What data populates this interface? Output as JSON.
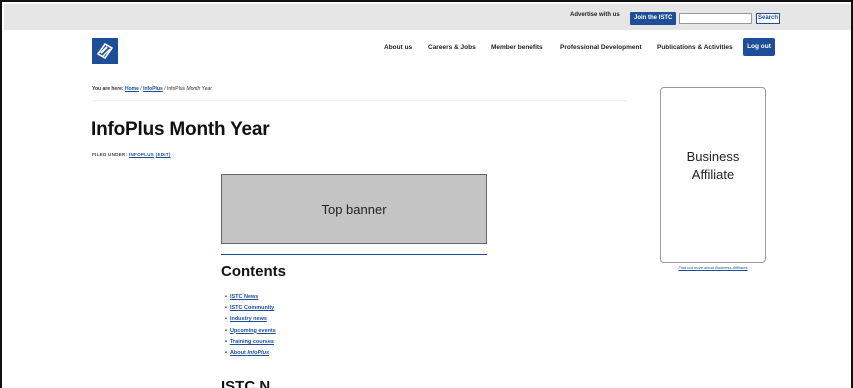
{
  "utility_bar": {
    "advertise_label": "Advertise with us",
    "join_label": "Join the ISTC",
    "search_value": "",
    "search_placeholder": "",
    "search_button_label": "Search"
  },
  "logo": {
    "alt": "ISTC"
  },
  "nav": {
    "items": [
      {
        "label": "About us"
      },
      {
        "label": "Careers & Jobs"
      },
      {
        "label": "Member benefits"
      },
      {
        "label": "Professional Development"
      },
      {
        "label": "Publications & Activities"
      }
    ],
    "logout_label": "Log out"
  },
  "breadcrumb": {
    "prefix": "You are here:",
    "home": "Home",
    "sep1": " / ",
    "section": "InfoPlus",
    "sep2": " / ",
    "current_bold": "InfoPlus",
    "current_rest": "Month Year"
  },
  "article": {
    "title": "InfoPlus Month Year",
    "filed_prefix": "FILED UNDER:",
    "filed_category": "INFOPLUS",
    "edit_label": "(EDIT)"
  },
  "banner": {
    "label": "Top banner"
  },
  "contents": {
    "heading": "Contents",
    "items": [
      {
        "label": "ISTC News"
      },
      {
        "label": "ISTC Community"
      },
      {
        "label": "Industry news"
      },
      {
        "label": "Upcoming events"
      },
      {
        "label": "Training courses"
      }
    ],
    "about_prefix": "About",
    "about_em": "InfoPlus"
  },
  "next_heading": "ISTC N",
  "sidebar": {
    "affiliate_line1": "Business",
    "affiliate_line2": "Affiliate",
    "affiliate_link": "Find out more about Business Affiliates"
  },
  "colors": {
    "brand_blue": "#1f4e98",
    "utility_bar_bg": "#e6e6e6",
    "banner_bg": "#c4c4c4"
  }
}
